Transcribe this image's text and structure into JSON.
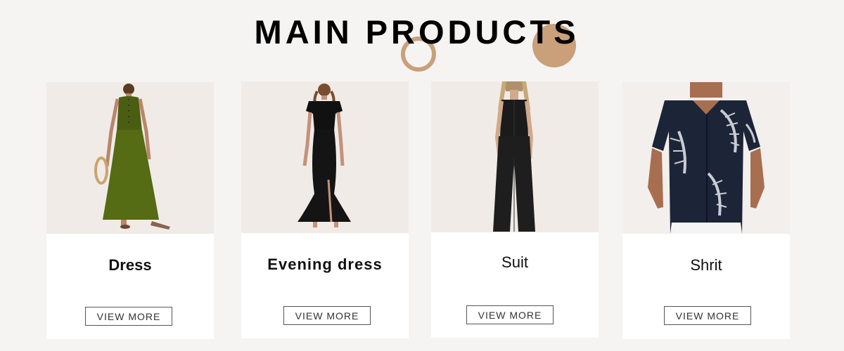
{
  "section": {
    "title": "MAIN PRODUCTS"
  },
  "colors": {
    "accent": "#c9a07a",
    "background": "#f5f4f2"
  },
  "products": [
    {
      "name": "Dress",
      "button_label": "VIEW MORE",
      "image": "olive-green-sleeveless-maxi-dress"
    },
    {
      "name": "Evening dress",
      "button_label": "VIEW MORE",
      "image": "black-off-shoulder-mermaid-gown"
    },
    {
      "name": "Suit",
      "button_label": "VIEW MORE",
      "image": "black-vest-and-wide-leg-pants"
    },
    {
      "name": "Shrit",
      "button_label": "VIEW MORE",
      "image": "navy-leaf-print-shirt"
    }
  ]
}
